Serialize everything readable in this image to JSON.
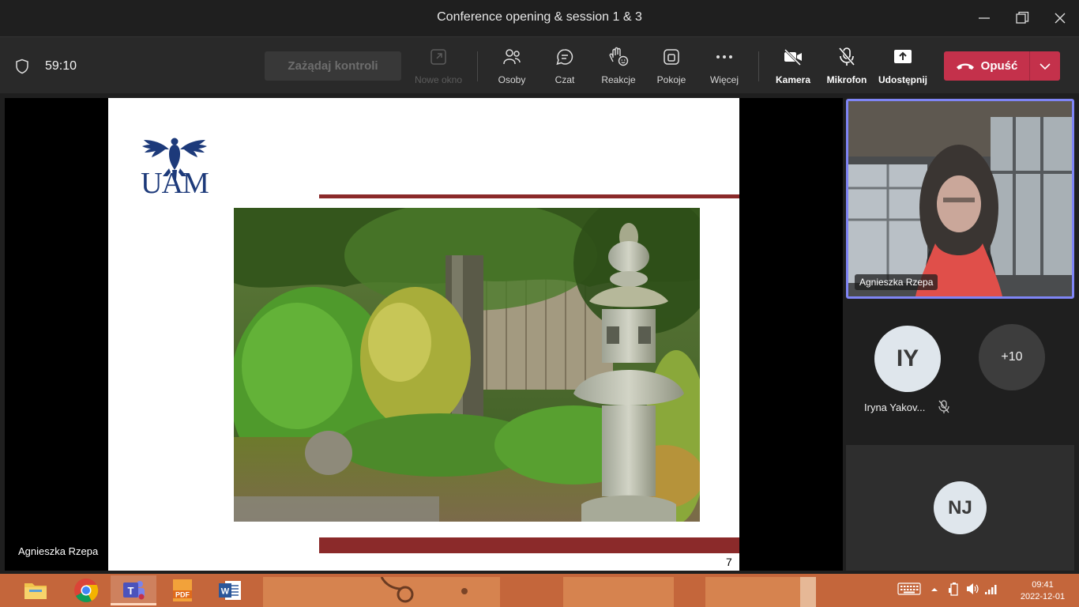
{
  "window": {
    "title": "Conference opening & session 1 & 3"
  },
  "toolbar": {
    "timer": "59:10",
    "request_control": "Zażądaj kontroli",
    "items": [
      {
        "label": "Nowe okno",
        "icon": "popout-icon"
      },
      {
        "label": "Osoby",
        "icon": "people-icon"
      },
      {
        "label": "Czat",
        "icon": "chat-icon"
      },
      {
        "label": "Reakcje",
        "icon": "reactions-icon"
      },
      {
        "label": "Pokoje",
        "icon": "rooms-icon"
      },
      {
        "label": "Więcej",
        "icon": "more-icon"
      },
      {
        "label": "Kamera",
        "icon": "camera-off-icon"
      },
      {
        "label": "Mikrofon",
        "icon": "mic-off-icon"
      },
      {
        "label": "Udostępnij",
        "icon": "share-icon"
      }
    ],
    "leave_label": "Opuść",
    "colors": {
      "leave": "#c4314b",
      "accent": "#7f85f5"
    }
  },
  "stage": {
    "logo_text": "UAM",
    "page_number": "7",
    "presenter": "Agnieszka Rzepa"
  },
  "participants": {
    "video_name": "Agnieszka Rzepa",
    "iy_initials": "IY",
    "iy_name": "Iryna Yakov...",
    "more_count": "+10",
    "nj_initials": "NJ"
  },
  "taskbar": {
    "apps": [
      "file-explorer",
      "chrome",
      "teams",
      "pdf-reader",
      "word"
    ],
    "time": "09:41",
    "date": "2022-12-01"
  }
}
